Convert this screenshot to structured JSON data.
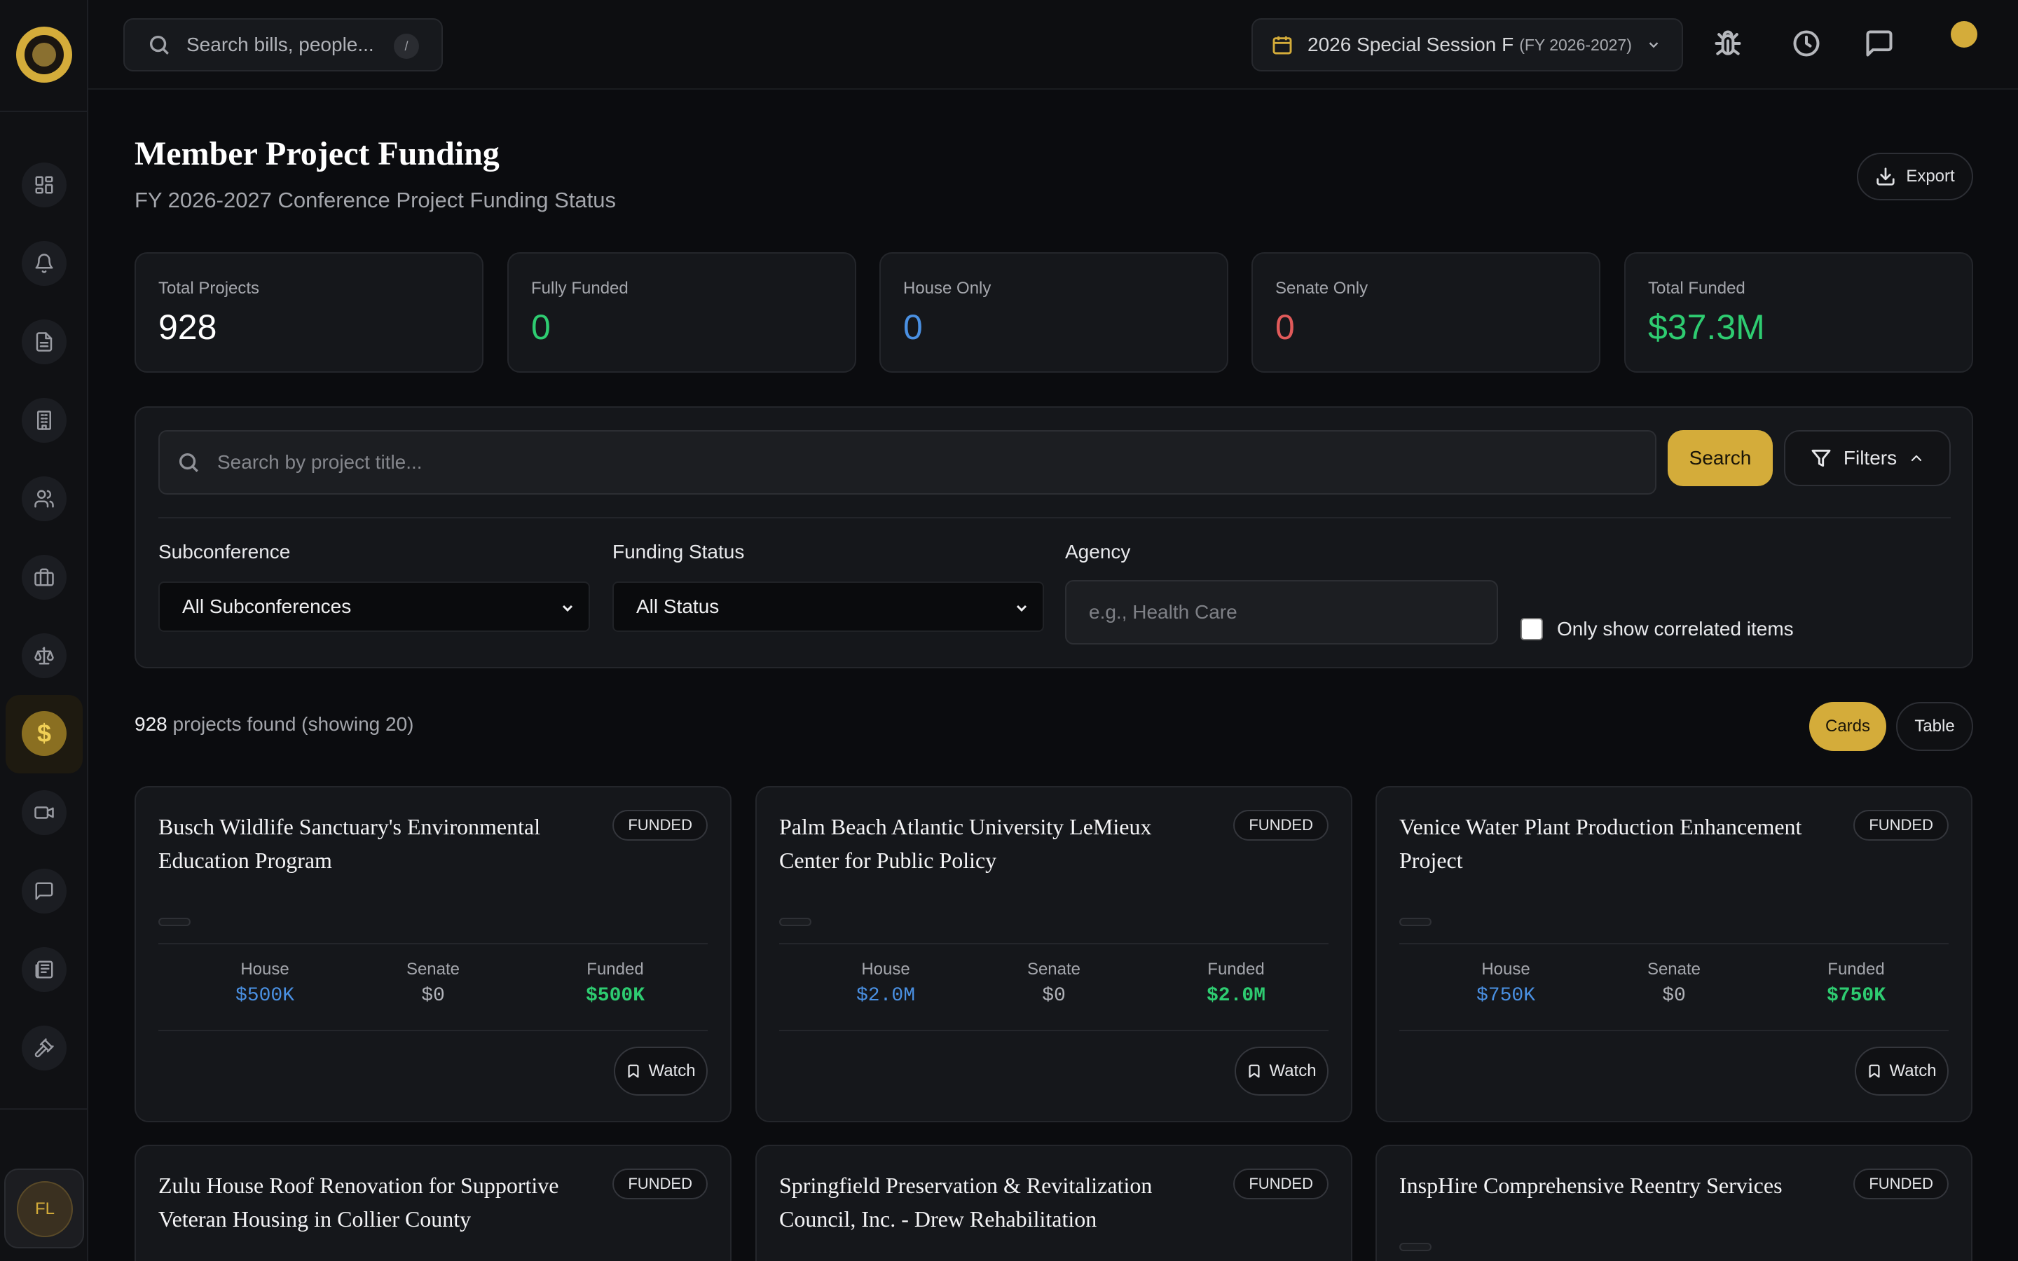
{
  "topbar": {
    "search_placeholder": "Search bills, people...",
    "shortcut_key": "/",
    "session_main": "2026 Special Session F",
    "session_sub": "(FY 2026-2027)"
  },
  "sidebar": {
    "items": [
      {
        "icon": "dashboard-icon"
      },
      {
        "icon": "bell-icon"
      },
      {
        "icon": "document-icon"
      },
      {
        "icon": "building-icon"
      },
      {
        "icon": "users-icon"
      },
      {
        "icon": "briefcase-icon"
      },
      {
        "icon": "scale-icon"
      },
      {
        "icon": "dollar-icon",
        "active": true
      },
      {
        "icon": "video-icon"
      },
      {
        "icon": "chat-icon"
      },
      {
        "icon": "newspaper-icon"
      },
      {
        "icon": "gavel-icon"
      }
    ],
    "active_symbol": "$",
    "user_initials": "FL"
  },
  "header": {
    "title": "Member Project Funding",
    "subtitle": "FY 2026-2027 Conference Project Funding Status",
    "export_label": "Export"
  },
  "stats": [
    {
      "label": "Total Projects",
      "value": "928",
      "color": "#ffffff"
    },
    {
      "label": "Fully Funded",
      "value": "0",
      "color": "#2ecc71"
    },
    {
      "label": "House Only",
      "value": "0",
      "color": "#4a90e2"
    },
    {
      "label": "Senate Only",
      "value": "0",
      "color": "#e05a5a"
    },
    {
      "label": "Total Funded",
      "value": "$37.3M",
      "color": "#2ecc71"
    }
  ],
  "search": {
    "placeholder": "Search by project title...",
    "search_label": "Search",
    "filters_label": "Filters"
  },
  "filters": {
    "subconference_label": "Subconference",
    "subconference_value": "All Subconferences",
    "status_label": "Funding Status",
    "status_value": "All Status",
    "agency_label": "Agency",
    "agency_placeholder": "e.g., Health Care",
    "correlated_label": "Only show correlated items"
  },
  "results": {
    "count": "928",
    "text": "projects found (showing 20)",
    "cards_label": "Cards",
    "table_label": "Table"
  },
  "card_labels": {
    "house": "House",
    "senate": "Senate",
    "funded": "Funded",
    "watch": "Watch"
  },
  "colors": {
    "accent": "#d4ac3a",
    "house": "#4a90e2",
    "funded": "#2ecc71"
  },
  "projects": [
    {
      "title": "Busch Wildlife Sanctuary's Environmental Education Program",
      "status": "FUNDED",
      "house": "$500K",
      "senate": "$0",
      "funded": "$500K"
    },
    {
      "title": "Palm Beach Atlantic University LeMieux Center for Public Policy",
      "status": "FUNDED",
      "house": "$2.0M",
      "senate": "$0",
      "funded": "$2.0M"
    },
    {
      "title": "Venice Water Plant Production Enhancement Project",
      "status": "FUNDED",
      "house": "$750K",
      "senate": "$0",
      "funded": "$750K"
    },
    {
      "title": "Zulu House Roof Renovation for Supportive Veteran Housing in Collier County",
      "status": "FUNDED"
    },
    {
      "title": "Springfield Preservation & Revitalization Council, Inc. - Drew Rehabilitation",
      "status": "FUNDED"
    },
    {
      "title": "InspHire Comprehensive Reentry Services",
      "status": "FUNDED"
    }
  ]
}
